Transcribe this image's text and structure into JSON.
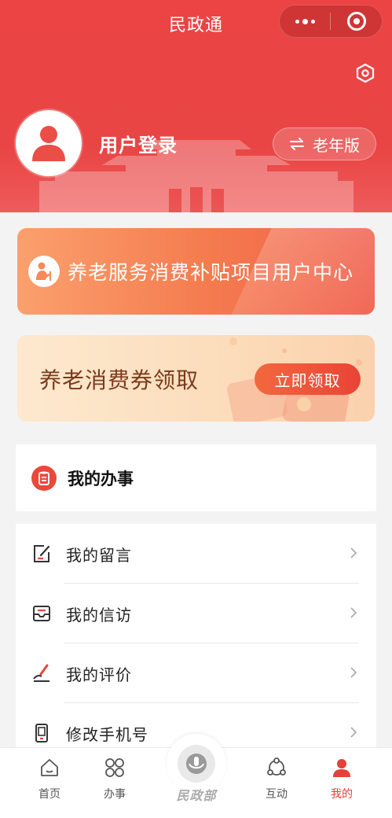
{
  "app": {
    "title": "民政通"
  },
  "profile": {
    "login_label": "用户登录",
    "elder_mode_label": "老年版"
  },
  "banners": {
    "subsidy_center": "养老服务消费补贴项目用户中心",
    "voucher_title": "养老消费券领取",
    "voucher_button": "立即领取"
  },
  "section": {
    "title": "我的办事"
  },
  "menu": [
    {
      "label": "我的留言",
      "icon": "edit-message-icon"
    },
    {
      "label": "我的信访",
      "icon": "inbox-tray-icon"
    },
    {
      "label": "我的评价",
      "icon": "rating-pen-icon"
    },
    {
      "label": "修改手机号",
      "icon": "phone-icon"
    }
  ],
  "tabbar": {
    "home": "首页",
    "services": "办事",
    "center": "民政部",
    "interact": "互动",
    "mine": "我的"
  },
  "colors": {
    "brand_red": "#e94545",
    "accent_orange": "#f47a4e",
    "tab_active": "#e3413a"
  }
}
